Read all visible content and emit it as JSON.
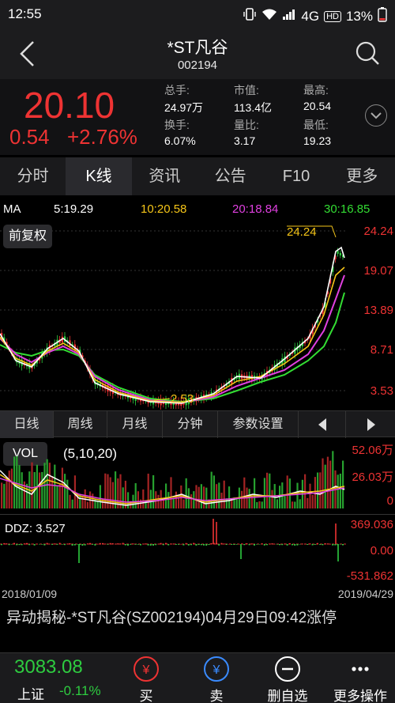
{
  "status_bar": {
    "time": "12:55",
    "network": "4G",
    "hd": "HD",
    "battery": "13%"
  },
  "header": {
    "title": "*ST凡谷",
    "code": "002194"
  },
  "quote": {
    "price": "20.10",
    "change": "0.54",
    "change_pct": "+2.76%",
    "fields": [
      {
        "label": "总手:",
        "value": "24.97万"
      },
      {
        "label": "市值:",
        "value": "113.4亿"
      },
      {
        "label": "最高:",
        "value": "20.54"
      },
      {
        "label": "换手:",
        "value": "6.07%"
      },
      {
        "label": "量比:",
        "value": "3.17"
      },
      {
        "label": "最低:",
        "value": "19.23"
      }
    ]
  },
  "tabs": [
    "分时",
    "K线",
    "资讯",
    "公告",
    "F10",
    "更多"
  ],
  "ma": {
    "label": "MA",
    "ma5": "5:19.29",
    "ma10": "10:20.58",
    "ma20": "20:18.84",
    "ma30": "30:16.85"
  },
  "kline": {
    "adjust_button": "前复权",
    "high_label": "24.24",
    "low_label": "2.53",
    "y_ticks": [
      "24.24",
      "19.07",
      "13.89",
      "8.71",
      "3.53"
    ]
  },
  "period_tabs": [
    "日线",
    "周线",
    "月线",
    "分钟",
    "参数设置"
  ],
  "volume": {
    "label": "VOL",
    "params": "(5,10,20)",
    "y_ticks": [
      "52.06万",
      "26.03万",
      "0"
    ]
  },
  "ddz": {
    "label": "DDZ: 3.527",
    "y_ticks": [
      "369.036",
      "0.00",
      "-531.862"
    ]
  },
  "date_range": {
    "start": "2018/01/09",
    "end": "2019/04/29"
  },
  "news": {
    "text": "异动揭秘-*ST凡谷(SZ002194)04月29日09:42涨停"
  },
  "bottom": {
    "index_value": "3083.08",
    "index_name": "上证",
    "index_pct": "-0.11%",
    "buy": "买",
    "sell": "卖",
    "remove": "删自选",
    "more": "更多操作"
  },
  "colors": {
    "up": "#ee3333",
    "down": "#2ecc40",
    "ma5": "#ffffff",
    "ma10": "#f5c518",
    "ma20": "#e040e0",
    "ma30": "#33dd33"
  }
}
